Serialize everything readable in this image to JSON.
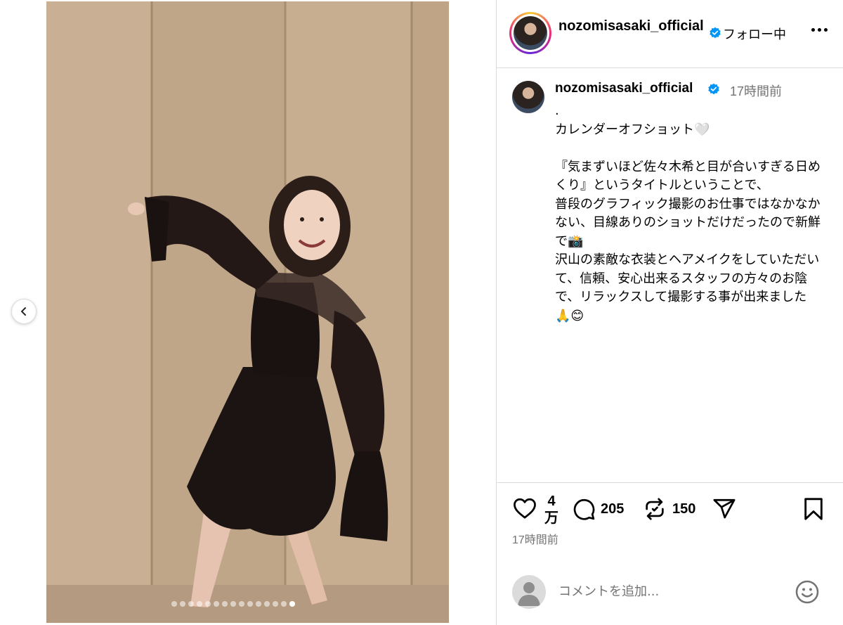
{
  "post": {
    "username": "nozomisasaki_official",
    "follow_status": "フォロー中",
    "more_icon": "more-horizontal-icon",
    "carousel": {
      "total": 15,
      "active_index": 14
    }
  },
  "caption": {
    "username": "nozomisasaki_official",
    "time": "17時間前",
    "text": ".\nカレンダーオフショット🤍\n\n『気まずいほど佐々木希と目が合いすぎる日めくり』というタイトルということで、\n普段のグラフィック撮影のお仕事ではなかなかない、目線ありのショットだけだったので新鮮で📸\n沢山の素敵な衣装とヘアメイクをしていただいて、信頼、安心出来るスタッフの方々のお陰で、リラックスして撮影する事が出来ました🙏😊"
  },
  "actions": {
    "likes": "4\n万",
    "comments": "205",
    "reposts": "150",
    "post_time": "17時間前"
  },
  "comment_box": {
    "placeholder": "コメントを追加..."
  },
  "colors": {
    "verified": "#0095f6",
    "muted_text": "#737373",
    "border": "#dbdbdb",
    "wall": "#c3aa8d"
  }
}
